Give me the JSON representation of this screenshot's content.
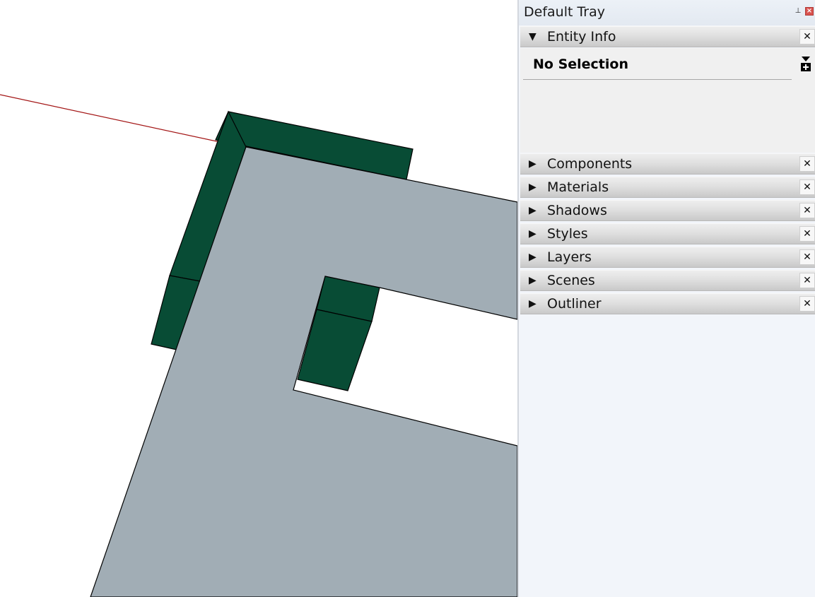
{
  "tray": {
    "title": "Default Tray",
    "pin_icon": "pin-icon",
    "close_icon": "close-icon"
  },
  "entity_info": {
    "label": "Entity Info",
    "expanded": true,
    "selection_text": "No Selection",
    "expand_icon": "expand-details-icon"
  },
  "panels": [
    {
      "label": "Components",
      "expanded": false
    },
    {
      "label": "Materials",
      "expanded": false
    },
    {
      "label": "Shadows",
      "expanded": false
    },
    {
      "label": "Styles",
      "expanded": false
    },
    {
      "label": "Layers",
      "expanded": false
    },
    {
      "label": "Scenes",
      "expanded": false
    },
    {
      "label": "Outliner",
      "expanded": false
    }
  ],
  "panel_close_glyph": "✕",
  "arrow_expanded": "▼",
  "arrow_collapsed": "▶",
  "colors": {
    "face": "#a1adb5",
    "side_face": "#084c35",
    "edge": "#000000",
    "red_axis": "#a31515",
    "tray_bg": "#f2f5fa"
  }
}
